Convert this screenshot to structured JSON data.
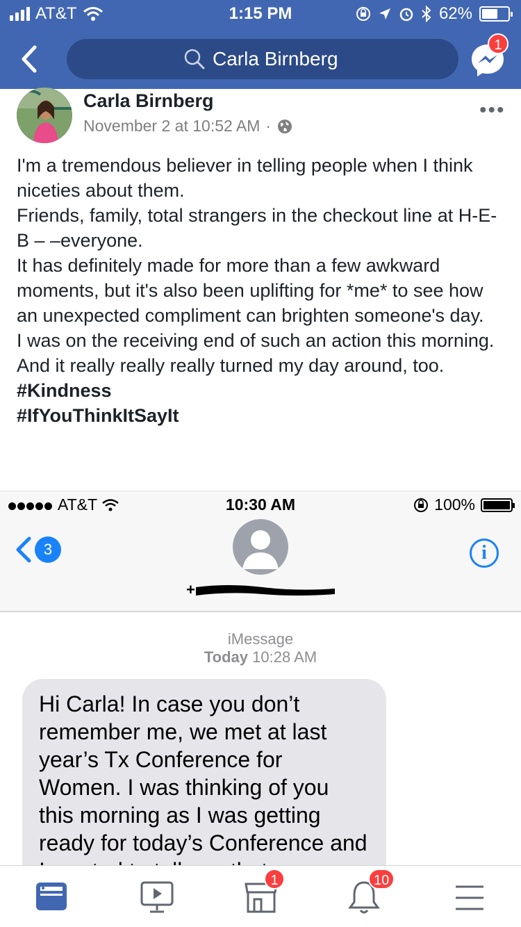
{
  "status_bar": {
    "carrier": "AT&T",
    "time": "1:15 PM",
    "battery": "62%",
    "battery_level": 0.62
  },
  "header": {
    "search_text": "Carla Birnberg",
    "messenger_badge": "1"
  },
  "post": {
    "author": "Carla Birnberg",
    "date": "November 2 at 10:52 AM",
    "separator": "·",
    "more": "•••",
    "lines": [
      "I'm a tremendous believer in telling people when I think niceties about them.",
      "Friends, family, total strangers in the checkout line at H-E-B – –everyone.",
      "It has definitely made for more than a few awkward moments, but it's also been uplifting for *me* to see how an unexpected compliment can brighten someone's day.",
      "I was on the receiving end of such an action this morning.",
      "And it really really really turned my day around, too."
    ],
    "hashtags": [
      "#Kindness",
      "#IfYouThinkItSayIt"
    ]
  },
  "embedded_screenshot": {
    "carrier": "AT&T",
    "time": "10:30 AM",
    "battery": "100%",
    "back_count": "3",
    "info": "i",
    "service_label": "iMessage",
    "date_day": "Today",
    "date_time": "10:28 AM",
    "message": "Hi Carla! In case you don’t remember me, we met at last year’s Tx Conference for Women. I was thinking of you this morning as I was getting ready for today’s Conference and I wanted to tell you that"
  },
  "tabbar": {
    "marketplace_badge": "1",
    "notifications_badge": "10"
  },
  "colors": {
    "facebook_blue": "#4267b2",
    "search_pill": "#2c4a87",
    "badge_red": "#fa3e3e",
    "ios_blue": "#1a82fb",
    "bubble_gray": "#e5e5ea"
  }
}
